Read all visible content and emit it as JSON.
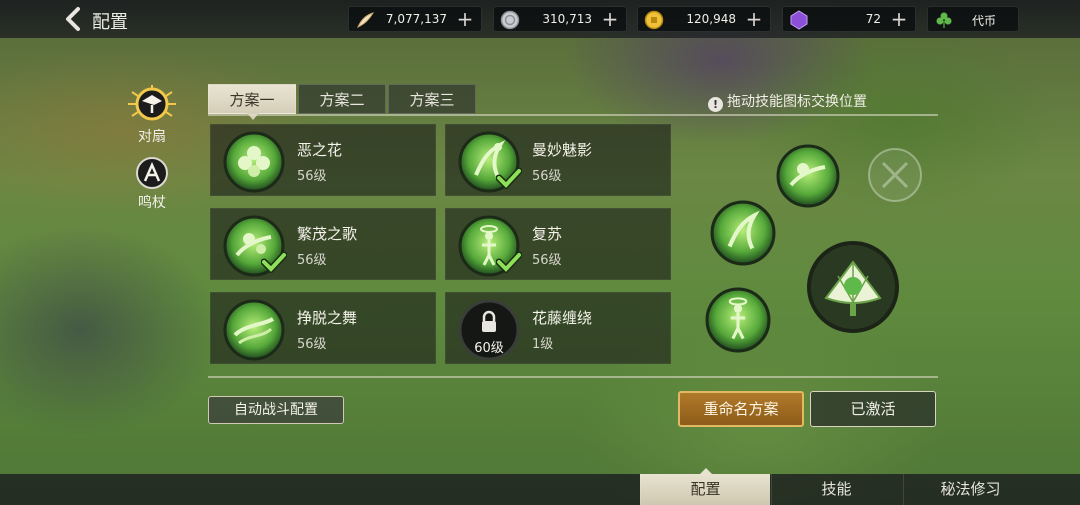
{
  "header": {
    "title": "配置"
  },
  "resources": {
    "quill": {
      "value": "7,077,137",
      "icon": "quill-icon"
    },
    "silver": {
      "value": "310,713",
      "icon": "silver-coin-icon"
    },
    "gold": {
      "value": "120,948",
      "icon": "gold-coin-icon"
    },
    "gem": {
      "value": "72",
      "icon": "purple-gem-icon"
    },
    "token": {
      "label": "代币",
      "icon": "clover-icon"
    }
  },
  "weapons": [
    {
      "label": "对扇",
      "icon": "fan-icon",
      "selected": true
    },
    {
      "label": "鸣杖",
      "icon": "staff-icon",
      "selected": false
    }
  ],
  "tabs": [
    {
      "label": "方案一",
      "active": true
    },
    {
      "label": "方案二",
      "active": false
    },
    {
      "label": "方案三",
      "active": false
    }
  ],
  "hint": {
    "text": "拖动技能图标交换位置"
  },
  "skills": [
    {
      "name": "恶之花",
      "level": "56级",
      "icon": "clover-flower-skill-icon",
      "equipped": false,
      "locked": false
    },
    {
      "name": "曼妙魅影",
      "level": "56级",
      "icon": "dancer-shadow-skill-icon",
      "equipped": true,
      "locked": false
    },
    {
      "name": "繁茂之歌",
      "level": "56级",
      "icon": "flourish-song-skill-icon",
      "equipped": true,
      "locked": false
    },
    {
      "name": "复苏",
      "level": "56级",
      "icon": "revive-skill-icon",
      "equipped": true,
      "locked": false
    },
    {
      "name": "挣脱之舞",
      "level": "56级",
      "icon": "breakfree-dance-skill-icon",
      "equipped": false,
      "locked": false
    },
    {
      "name": "花藤缠绕",
      "level": "1级",
      "lock_level": "60级",
      "icon": "lock-icon",
      "equipped": false,
      "locked": true
    }
  ],
  "buttons": {
    "auto_battle": "自动战斗配置",
    "rename": "重命名方案",
    "activated": "已激活"
  },
  "bottom_tabs": [
    {
      "label": "配置",
      "active": true
    },
    {
      "label": "技能",
      "active": false
    },
    {
      "label": "秘法修习",
      "active": false
    }
  ],
  "colors": {
    "skill_green": "#7ec850",
    "gold_button": "#b07a2a",
    "tab_cream": "#e9e4d2"
  }
}
